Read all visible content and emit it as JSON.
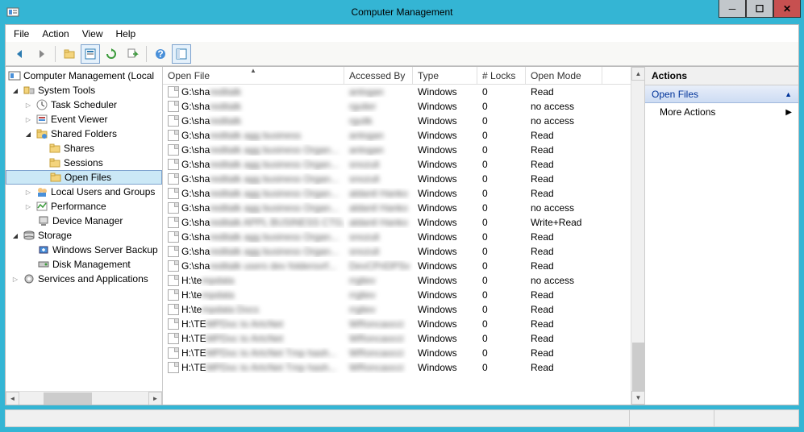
{
  "window": {
    "title": "Computer Management"
  },
  "menu": {
    "file": "File",
    "action": "Action",
    "view": "View",
    "help": "Help"
  },
  "tree": {
    "root": "Computer Management (Local",
    "system_tools": "System Tools",
    "task_scheduler": "Task Scheduler",
    "event_viewer": "Event Viewer",
    "shared_folders": "Shared Folders",
    "shares": "Shares",
    "sessions": "Sessions",
    "open_files": "Open Files",
    "local_users": "Local Users and Groups",
    "performance": "Performance",
    "device_manager": "Device Manager",
    "storage": "Storage",
    "ws_backup": "Windows Server Backup",
    "disk_mgmt": "Disk Management",
    "services": "Services and Applications"
  },
  "columns": {
    "open_file": "Open File",
    "accessed_by": "Accessed By",
    "type": "Type",
    "locks": "# Locks",
    "open_mode": "Open Mode"
  },
  "rows": [
    {
      "file": "G:\\sha",
      "file_blur": "reditalk",
      "by_blur": "anlogan",
      "type": "Windows",
      "locks": "0",
      "mode": "Read"
    },
    {
      "file": "G:\\sha",
      "file_blur": "reditalk",
      "by_blur": "rgulier",
      "type": "Windows",
      "locks": "0",
      "mode": "no access"
    },
    {
      "file": "G:\\sha",
      "file_blur": "reditalk",
      "by_blur": "rgulik",
      "type": "Windows",
      "locks": "0",
      "mode": "no access"
    },
    {
      "file": "G:\\sha",
      "file_blur": "reditalk agg business",
      "by_blur": "anlogan",
      "type": "Windows",
      "locks": "0",
      "mode": "Read"
    },
    {
      "file": "G:\\sha",
      "file_blur": "reditalk agg business Organ...",
      "by_blur": "anlogan",
      "type": "Windows",
      "locks": "0",
      "mode": "Read"
    },
    {
      "file": "G:\\sha",
      "file_blur": "reditalk agg business Organ...",
      "by_blur": "snozuli",
      "type": "Windows",
      "locks": "0",
      "mode": "Read"
    },
    {
      "file": "G:\\sha",
      "file_blur": "reditalk agg business Organ...",
      "by_blur": "snozuli",
      "type": "Windows",
      "locks": "0",
      "mode": "Read"
    },
    {
      "file": "G:\\sha",
      "file_blur": "reditalk agg business Organ...",
      "by_blur": "aldanil Hanko",
      "type": "Windows",
      "locks": "0",
      "mode": "Read"
    },
    {
      "file": "G:\\sha",
      "file_blur": "reditalk agg business Organ...",
      "by_blur": "aldanil Hanko",
      "type": "Windows",
      "locks": "0",
      "mode": "no access"
    },
    {
      "file": "G:\\sha",
      "file_blur": "reditalk APPL BUSINESS CTG...",
      "by_blur": "aldanil Hanko",
      "type": "Windows",
      "locks": "0",
      "mode": "Write+Read"
    },
    {
      "file": "G:\\sha",
      "file_blur": "reditalk agg business Organ...",
      "by_blur": "snozuli",
      "type": "Windows",
      "locks": "0",
      "mode": "Read"
    },
    {
      "file": "G:\\sha",
      "file_blur": "reditalk agg business Organ...",
      "by_blur": "snozuli",
      "type": "Windows",
      "locks": "0",
      "mode": "Read"
    },
    {
      "file": "G:\\sha",
      "file_blur": "reditalk users dev foldersvrf...",
      "by_blur": "DevCPriDPSv",
      "type": "Windows",
      "locks": "0",
      "mode": "Read"
    },
    {
      "file": "H:\\te",
      "file_blur": "mpdata",
      "by_blur": "rrgliev",
      "type": "Windows",
      "locks": "0",
      "mode": "no access"
    },
    {
      "file": "H:\\te",
      "file_blur": "mpdata",
      "by_blur": "rrgliev",
      "type": "Windows",
      "locks": "0",
      "mode": "Read"
    },
    {
      "file": "H:\\te",
      "file_blur": "mpdata Docs",
      "by_blur": "rrgliev",
      "type": "Windows",
      "locks": "0",
      "mode": "Read"
    },
    {
      "file": "H:\\TE",
      "file_blur": "MPDoc to ArtcNet",
      "by_blur": "WRoncaocci",
      "type": "Windows",
      "locks": "0",
      "mode": "Read"
    },
    {
      "file": "H:\\TE",
      "file_blur": "MPDoc to ArtcNet",
      "by_blur": "WRoncaocci",
      "type": "Windows",
      "locks": "0",
      "mode": "Read"
    },
    {
      "file": "H:\\TE",
      "file_blur": "MPDoc to ArtcNet Tmp hash...",
      "by_blur": "WRoncaocci",
      "type": "Windows",
      "locks": "0",
      "mode": "Read"
    },
    {
      "file": "H:\\TE",
      "file_blur": "MPDoc to ArtcNet Tmp hash...",
      "by_blur": "WRoncaocci",
      "type": "Windows",
      "locks": "0",
      "mode": "Read"
    }
  ],
  "actions": {
    "header": "Actions",
    "section": "Open Files",
    "more": "More Actions"
  }
}
